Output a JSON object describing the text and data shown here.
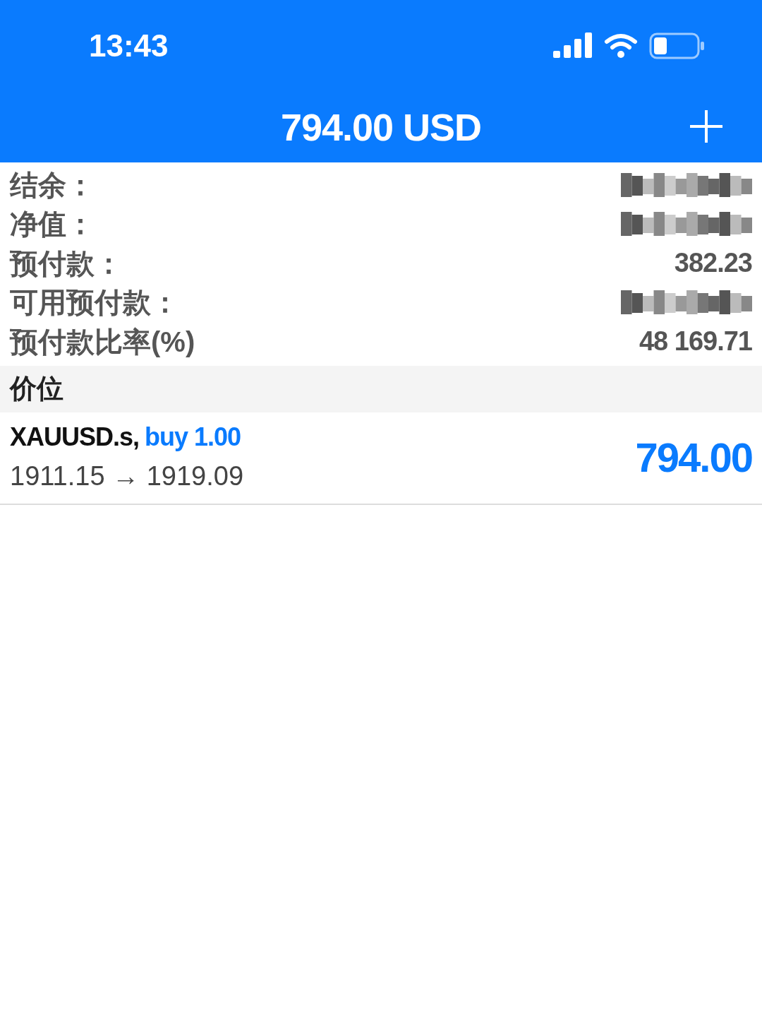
{
  "status_bar": {
    "time": "13:43"
  },
  "header": {
    "title": "794.00 USD"
  },
  "account": [
    {
      "label": "结余：",
      "kind": "redacted"
    },
    {
      "label": "净值：",
      "kind": "redacted"
    },
    {
      "label": "预付款：",
      "kind": "text",
      "value": "382.23"
    },
    {
      "label": "可用预付款：",
      "kind": "redacted"
    },
    {
      "label": "预付款比率(%)",
      "kind": "text",
      "value": "48 169.71"
    }
  ],
  "section": {
    "title": "价位"
  },
  "positions": [
    {
      "symbol": "XAUUSD.s,",
      "side": "buy 1.00",
      "prices": "1911.15 → 1919.09",
      "profit": "794.00"
    }
  ]
}
